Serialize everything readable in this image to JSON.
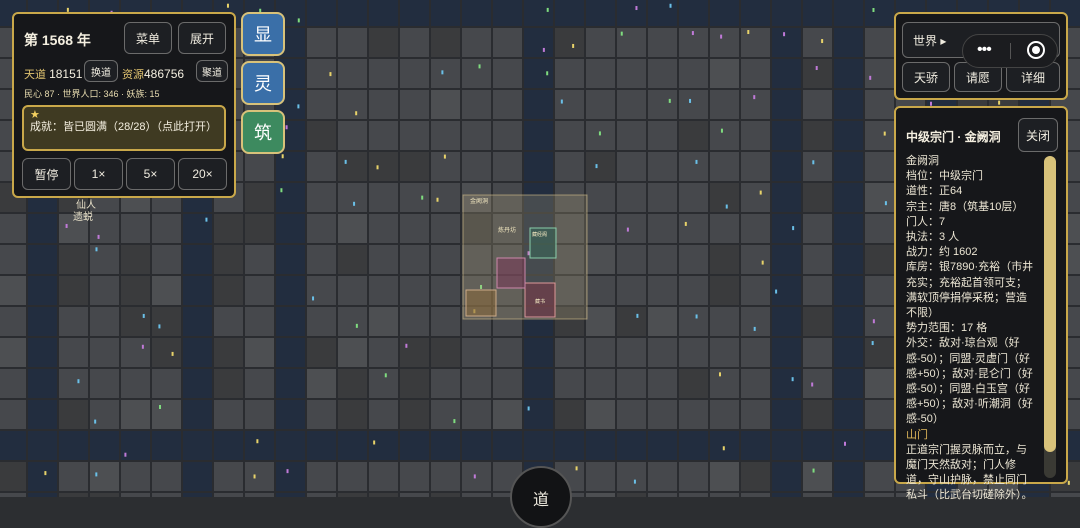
{
  "top_panel": {
    "year_label": "第 1568 年",
    "menu_label": "菜单",
    "expand_label": "展开",
    "tiandao_label": "天道",
    "tiandao_value": "18151",
    "swap_label": "换道",
    "resource_label": "资源",
    "resource_value": "486756",
    "gather_label": "聚道",
    "stats_line": "民心 87 · 世界人口: 346 · 妖族: 15",
    "achievement_star": "★",
    "achievement_text": "成就：皆已圆满（28/28）（点此打开）",
    "speed_buttons": [
      "暂停",
      "1×",
      "5×",
      "20×"
    ]
  },
  "side_buttons": [
    {
      "label": "显",
      "color": "#3a6fa8"
    },
    {
      "label": "灵",
      "color": "#3a6fa8"
    },
    {
      "label": "筑",
      "color": "#3d8a5f"
    }
  ],
  "world_panel": {
    "world_label": "世界 ▸",
    "tianjiao_label": "天骄",
    "qingyuan_label": "请愿",
    "detail_label": "详细"
  },
  "detail_panel": {
    "title": "中级宗门 · 金阙洞",
    "close_label": "关闭",
    "lines": [
      "金阙洞",
      "档位：中级宗门",
      "道性：正64",
      "宗主：唐8（筑基10层）",
      "门人：7",
      "执法：3 人",
      "战力：约 1602",
      "库房：银7890·充裕（市井充实；充裕起首领可支；满软顶停捐停采税；营造不限）",
      "势力范围：17 格",
      "外交：敌对·琼台观（好感-50）；同盟·灵虚门（好感+50）；敌对·昆仑门（好感-50）；同盟·白玉宫（好感+50）；敌对·听潮洞（好感-50）"
    ],
    "section_title": "山门",
    "section_text": "正道宗门握灵脉而立，与魔门天然敌对；门人修道，守山护脉，禁止同门私斗（比武台切磋除外）。"
  },
  "map_labels": {
    "immortal_relic": "仙人遗蜕",
    "bottom_button": "道",
    "sect_title": "金阙洞",
    "sect_hall": "炼丹坊",
    "scripture": "藏经阁",
    "library": "藏书"
  },
  "colors": {
    "accent_gold": "#c9a84a",
    "river": "#1f2a3d",
    "tile": "#45474b",
    "grid": "#2a2b2e"
  }
}
